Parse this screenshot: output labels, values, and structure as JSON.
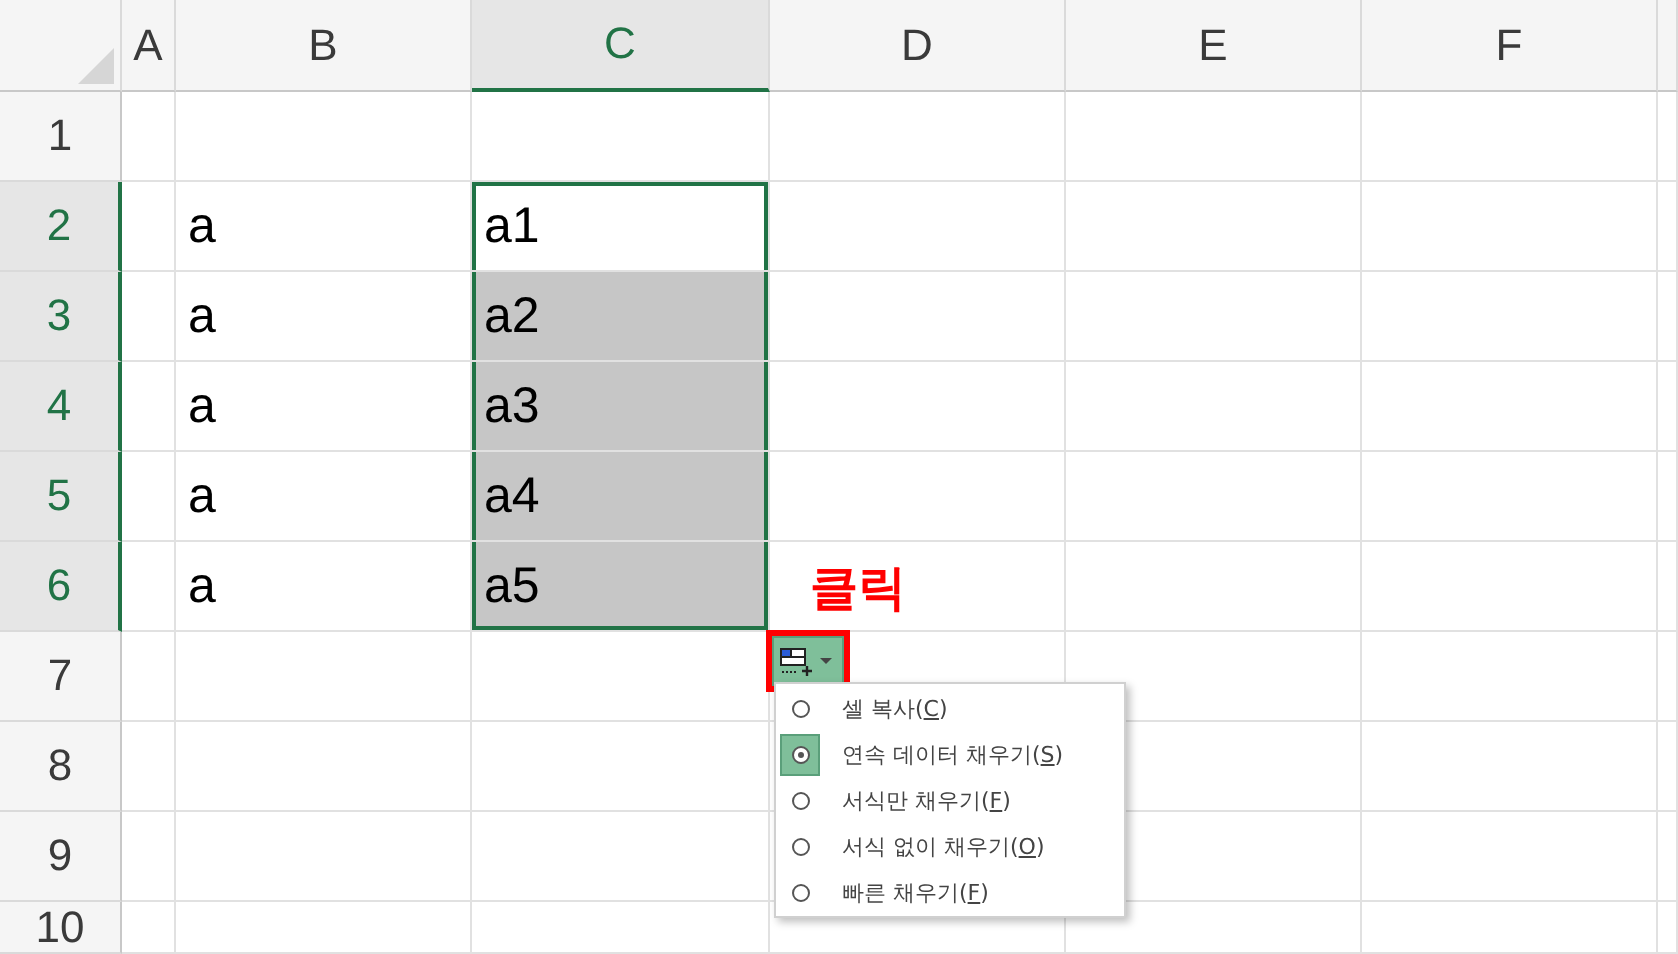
{
  "columns": [
    {
      "label": "A",
      "selected": false
    },
    {
      "label": "B",
      "selected": false
    },
    {
      "label": "C",
      "selected": true
    },
    {
      "label": "D",
      "selected": false
    },
    {
      "label": "E",
      "selected": false
    },
    {
      "label": "F",
      "selected": false
    }
  ],
  "rows": [
    {
      "header": "1",
      "selected": false
    },
    {
      "header": "2",
      "selected": true,
      "column_b": "a",
      "column_c": "a1",
      "c_shaded": false
    },
    {
      "header": "3",
      "selected": true,
      "column_b": "a",
      "column_c": "a2",
      "c_shaded": true
    },
    {
      "header": "4",
      "selected": true,
      "column_b": "a",
      "column_c": "a3",
      "c_shaded": true
    },
    {
      "header": "5",
      "selected": true,
      "column_b": "a",
      "column_c": "a4",
      "c_shaded": true
    },
    {
      "header": "6",
      "selected": true,
      "column_b": "a",
      "column_c": "a5",
      "c_shaded": true
    },
    {
      "header": "7",
      "selected": false
    },
    {
      "header": "8",
      "selected": false
    },
    {
      "header": "9",
      "selected": false
    },
    {
      "header": "10",
      "selected": false
    }
  ],
  "annotation": {
    "text": "클릭"
  },
  "autofill_menu": {
    "items": [
      {
        "text_before": "셀 복사(",
        "mnemonic": "C",
        "text_after": ")",
        "selected": false
      },
      {
        "text_before": "연속 데이터 채우기(",
        "mnemonic": "S",
        "text_after": ")",
        "selected": true
      },
      {
        "text_before": "서식만 채우기(",
        "mnemonic": "F",
        "text_after": ")",
        "selected": false
      },
      {
        "text_before": "서식 없이 채우기(",
        "mnemonic": "O",
        "text_after": ")",
        "selected": false
      },
      {
        "text_before": "빠른 채우기(",
        "mnemonic": "F",
        "text_after": ")",
        "selected": false
      }
    ]
  }
}
